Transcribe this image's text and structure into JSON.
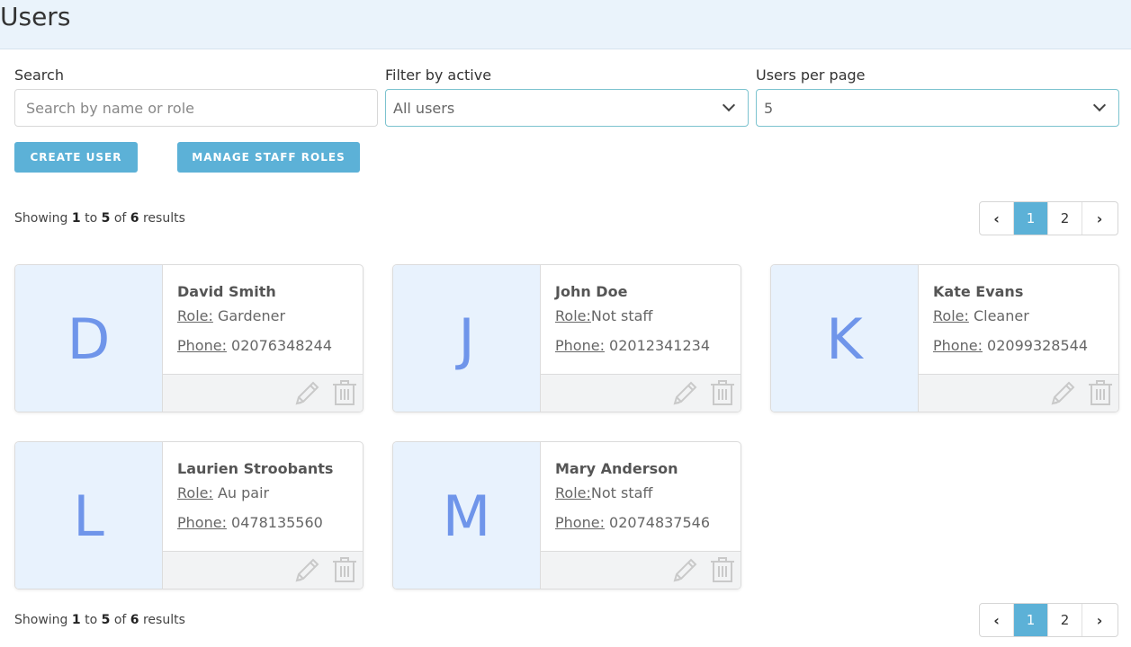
{
  "page": {
    "title": "Users"
  },
  "filters": {
    "search_label": "Search",
    "search_placeholder": "Search by name or role",
    "active_label": "Filter by active",
    "active_value": "All users",
    "per_page_label": "Users per page",
    "per_page_value": "5"
  },
  "buttons": {
    "create": "CREATE USER",
    "manage_roles": "MANAGE STAFF ROLES"
  },
  "summary": {
    "prefix": "Showing",
    "from": "1",
    "to_word": "to",
    "to": "5",
    "of_word": "of",
    "total": "6",
    "suffix": "results"
  },
  "pagination": {
    "prev": "‹",
    "pages": [
      "1",
      "2"
    ],
    "next": "›",
    "active_page": "1"
  },
  "labels": {
    "role": "Role:",
    "phone": "Phone:"
  },
  "users": [
    {
      "initial": "D",
      "name": "David Smith",
      "role": " Gardener",
      "phone": " 02076348244"
    },
    {
      "initial": "J",
      "name": "John Doe",
      "role": "Not staff",
      "phone": " 02012341234"
    },
    {
      "initial": "K",
      "name": "Kate Evans",
      "role": " Cleaner",
      "phone": " 02099328544"
    },
    {
      "initial": "L",
      "name": "Laurien Stroobants",
      "role": " Au pair",
      "phone": " 0478135560"
    },
    {
      "initial": "M",
      "name": "Mary Anderson",
      "role": "Not staff",
      "phone": " 02074837546"
    }
  ],
  "icons": {
    "edit": "pencil-icon",
    "delete": "trash-icon"
  },
  "colors": {
    "accent": "#5cb1d7",
    "avatar_bg": "#e8f2fd",
    "avatar_letter": "#6f95ea",
    "header_bg": "#eaf3fb"
  }
}
